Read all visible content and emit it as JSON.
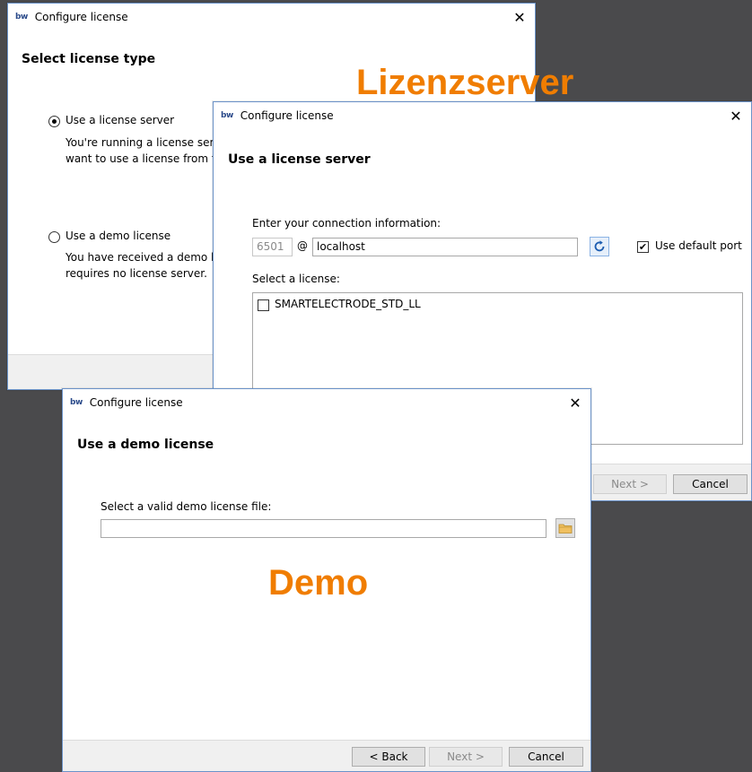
{
  "dialog_select": {
    "window_title": "Configure license",
    "app_icon": "bw",
    "heading": "Select license type",
    "options": [
      {
        "label": "Use a license server",
        "checked": true,
        "desc_line1": "You're running a license serv",
        "desc_line2": "want to use a license from th"
      },
      {
        "label": "Use a demo license",
        "checked": false,
        "desc_line1": "You have received a demo li",
        "desc_line2": "requires no license server."
      }
    ]
  },
  "dialog_server": {
    "window_title": "Configure license",
    "app_icon": "bw",
    "heading": "Use a license server",
    "connection_label": "Enter your connection information:",
    "port_value": "6501",
    "at_symbol": "@",
    "host_value": "localhost",
    "use_default_port_label": "Use default port",
    "use_default_port_checked": true,
    "select_license_label": "Select a license:",
    "licenses": [
      {
        "name": "SMARTELECTRODE_STD_LL",
        "checked": false
      }
    ],
    "next_label": "Next >",
    "cancel_label": "Cancel"
  },
  "dialog_demo": {
    "window_title": "Configure license",
    "app_icon": "bw",
    "heading": "Use a demo license",
    "file_label": "Select a valid demo license file:",
    "file_value": "",
    "back_label": "< Back",
    "next_label": "Next >",
    "cancel_label": "Cancel"
  },
  "annotations": {
    "server": "Lizenzserver",
    "demo": "Demo"
  },
  "colors": {
    "annotation": "#f07d00",
    "border": "#6b93c9",
    "background": "#4a4a4c"
  },
  "icons": {
    "close": "close-icon",
    "refresh": "refresh-icon",
    "folder": "folder-icon"
  }
}
